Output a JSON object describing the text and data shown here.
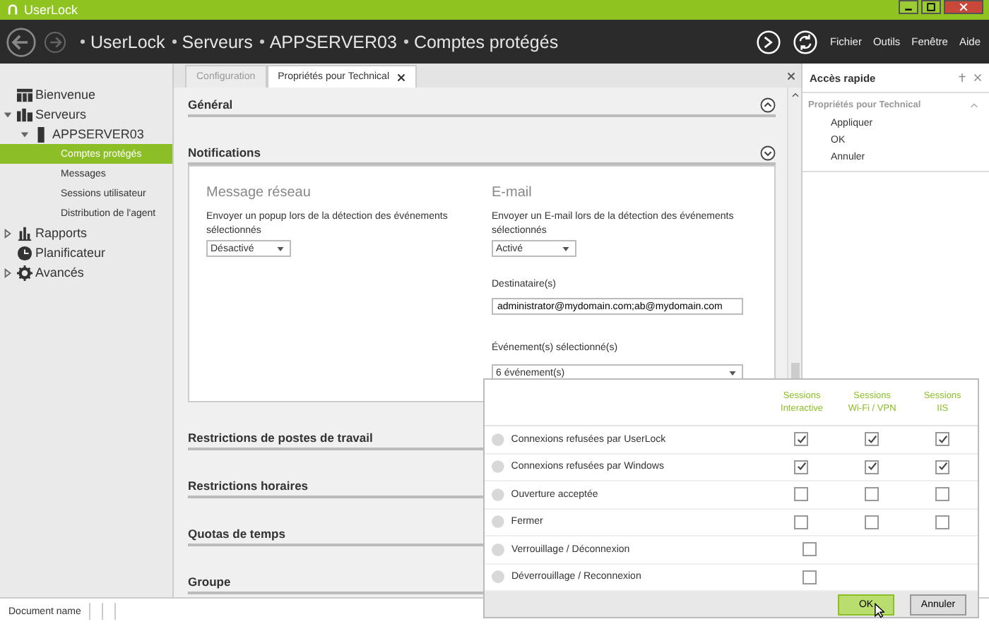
{
  "window": {
    "title": "UserLock"
  },
  "breadcrumb": [
    "UserLock",
    "Serveurs",
    "APPSERVER03",
    "Comptes protégés"
  ],
  "menu": [
    "Fichier",
    "Outils",
    "Fenêtre",
    "Aide"
  ],
  "sidebar": {
    "items": [
      {
        "label": "Bienvenue",
        "kind": "home",
        "selected": false
      },
      {
        "label": "Serveurs",
        "kind": "servers",
        "selected": false,
        "expanded": true,
        "children": [
          {
            "label": "APPSERVER03",
            "kind": "server",
            "selected": false,
            "expanded": true,
            "children": [
              {
                "label": "Comptes protégés",
                "selected": true
              },
              {
                "label": "Messages",
                "selected": false
              },
              {
                "label": "Sessions utilisateur",
                "selected": false
              },
              {
                "label": "Distribution de l'agent",
                "selected": false
              }
            ]
          }
        ]
      },
      {
        "label": "Rapports",
        "kind": "reports",
        "selected": false,
        "expanded": false
      },
      {
        "label": "Planificateur",
        "kind": "scheduler",
        "selected": false
      },
      {
        "label": "Avancés",
        "kind": "settings",
        "selected": false,
        "expanded": false
      }
    ]
  },
  "tabs": [
    {
      "label": "Configuration",
      "selected": false
    },
    {
      "label": "Propriétés pour Technical",
      "selected": true,
      "closable": true
    }
  ],
  "sections": [
    {
      "title": "Général",
      "expanded": false
    },
    {
      "title": "Notifications",
      "expanded": true
    },
    {
      "title": "Restrictions de postes de travail",
      "expanded": false
    },
    {
      "title": "Restrictions horaires",
      "expanded": false
    },
    {
      "title": "Quotas de temps",
      "expanded": false
    },
    {
      "title": "Groupe",
      "expanded": false
    }
  ],
  "notifications": {
    "network": {
      "heading": "Message réseau",
      "description": "Envoyer un popup lors de la détection des événements sélectionnés",
      "value": "Désactivé"
    },
    "email": {
      "heading": "E-mail",
      "description": "Envoyer un E-mail lors de la détection des événements sélectionnés",
      "value": "Activé",
      "recipients_label": "Destinataire(s)",
      "recipients": "administrator@mydomain.com;ab@mydomain.com",
      "events_label": "Événement(s) sélectionné(s)",
      "events_value": "6 événement(s)"
    }
  },
  "events_popup": {
    "columns": [
      [
        "Sessions",
        "Interactive"
      ],
      [
        "Sessions",
        "Wi-Fi / VPN"
      ],
      [
        "Sessions",
        "IIS"
      ]
    ],
    "rows": [
      {
        "label": "Connexions refusées par UserLock",
        "checks": [
          true,
          true,
          true
        ]
      },
      {
        "label": "Connexions refusées par Windows",
        "checks": [
          true,
          true,
          true
        ]
      },
      {
        "label": "Ouverture acceptée",
        "checks": [
          false,
          false,
          false
        ]
      },
      {
        "label": "Fermer",
        "checks": [
          false,
          false,
          false
        ]
      },
      {
        "label": "Verrouillage / Déconnexion",
        "checks": [
          false
        ]
      },
      {
        "label": "Déverrouillage / Reconnexion",
        "checks": [
          false
        ]
      }
    ],
    "buttons": [
      "OK",
      "Annuler"
    ]
  },
  "quick_access": {
    "title": "Accès rapide",
    "section": "Propriétés pour Technical",
    "links": [
      "Appliquer",
      "OK",
      "Annuler"
    ]
  },
  "status_bar": {
    "document": "Document name"
  }
}
